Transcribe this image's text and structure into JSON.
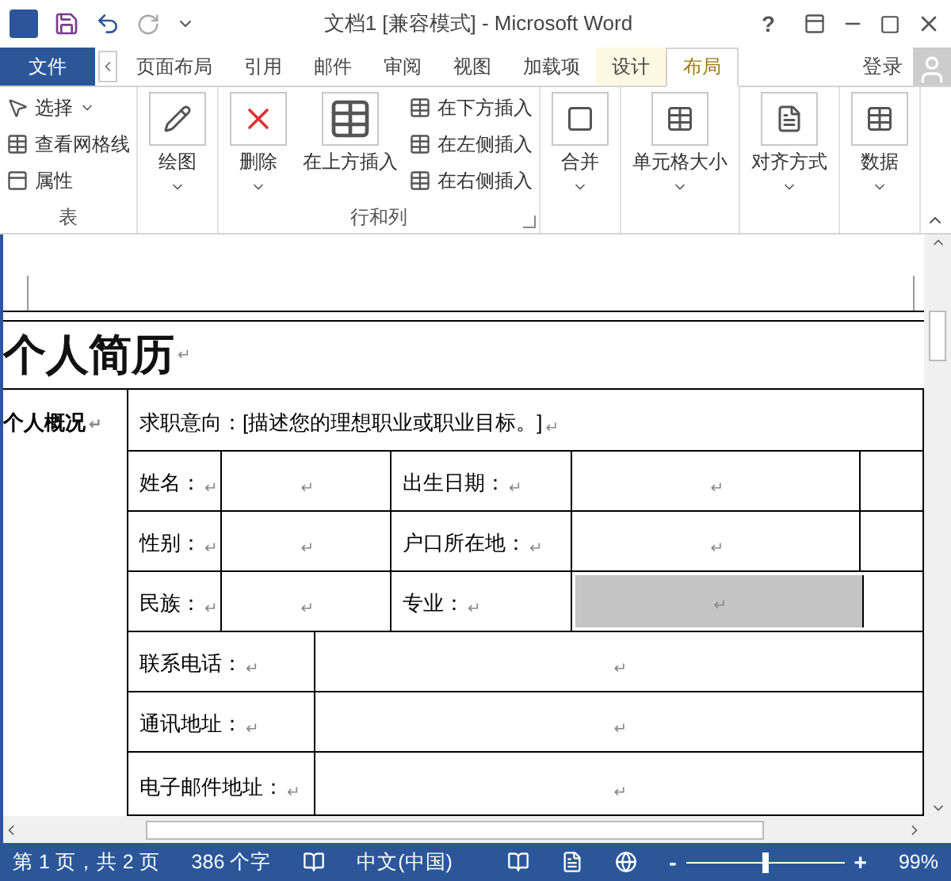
{
  "title_bar": {
    "title": "文档1 [兼容模式] - Microsoft Word",
    "help": "?"
  },
  "ribbon_tabs": [
    {
      "label": "文件",
      "kind": "file",
      "selected": false
    },
    {
      "label": "页面布局",
      "kind": "normal",
      "selected": false
    },
    {
      "label": "引用",
      "kind": "normal",
      "selected": false
    },
    {
      "label": "邮件",
      "kind": "normal",
      "selected": false
    },
    {
      "label": "审阅",
      "kind": "normal",
      "selected": false
    },
    {
      "label": "视图",
      "kind": "normal",
      "selected": false
    },
    {
      "label": "加载项",
      "kind": "normal",
      "selected": false
    },
    {
      "label": "设计",
      "kind": "context",
      "selected": false
    },
    {
      "label": "布局",
      "kind": "context",
      "selected": true
    }
  ],
  "sign_in": "登录",
  "ribbon_groups": [
    {
      "label": "表",
      "items": [
        {
          "kind": "small",
          "label": "选择",
          "caret": true
        },
        {
          "kind": "small",
          "label": "查看网格线",
          "caret": false
        },
        {
          "kind": "small",
          "label": "属性",
          "caret": false
        }
      ]
    },
    {
      "items": [
        {
          "kind": "large",
          "label": "绘图",
          "caret": true
        }
      ]
    },
    {
      "label": "行和列",
      "launcher": true,
      "items": [
        {
          "kind": "large",
          "label": "删除",
          "caret": true
        },
        {
          "kind": "large",
          "label": "在上方插入",
          "caret": false
        },
        {
          "kind": "small",
          "label": "在下方插入",
          "caret": false
        },
        {
          "kind": "small",
          "label": "在左侧插入",
          "caret": false
        },
        {
          "kind": "small",
          "label": "在右侧插入",
          "caret": false
        }
      ]
    },
    {
      "items": [
        {
          "kind": "large",
          "label": "合并",
          "caret": true
        }
      ]
    },
    {
      "items": [
        {
          "kind": "large",
          "label": "单元格大小",
          "caret": true
        }
      ]
    },
    {
      "items": [
        {
          "kind": "large",
          "label": "对齐方式",
          "caret": true
        }
      ]
    },
    {
      "items": [
        {
          "kind": "large",
          "label": "数据",
          "caret": true
        }
      ]
    }
  ],
  "document": {
    "title": "个人简历",
    "title_end": "↵",
    "section": "个人概况",
    "section_end": "↵",
    "objective": "求职意向：[描述您的理想职业或职业目标。]",
    "objective_end": "↵",
    "grid_rows": [
      [
        {
          "text": "姓名：",
          "end": "↵",
          "shaded": false
        },
        {
          "text": "",
          "end": "↵",
          "shaded": false
        },
        {
          "text": "出生日期：",
          "end": "↵",
          "shaded": false
        },
        {
          "text": "",
          "end": "↵",
          "shaded": false
        }
      ],
      [
        {
          "text": "性别：",
          "end": "↵",
          "shaded": false
        },
        {
          "text": "",
          "end": "↵",
          "shaded": false
        },
        {
          "text": "户口所在地：",
          "end": "↵",
          "shaded": false
        },
        {
          "text": "",
          "end": "↵",
          "shaded": false
        }
      ],
      [
        {
          "text": "民族：",
          "end": "↵",
          "shaded": false
        },
        {
          "text": "",
          "end": "↵",
          "shaded": false
        },
        {
          "text": "专业：",
          "end": "↵",
          "shaded": false
        },
        {
          "text": "",
          "end": "↵",
          "shaded": true
        }
      ]
    ],
    "wide_rows": [
      {
        "label": "联系电话：",
        "label_end": "↵",
        "value_end": "↵"
      },
      {
        "label": "通讯地址：",
        "label_end": "↵",
        "value_end": "↵"
      },
      {
        "label": "电子邮件地址：",
        "label_end": "↵",
        "value_end": "↵"
      }
    ]
  },
  "status_bar": {
    "page": "第 1 页，共 2 页",
    "words": "386 个字",
    "language": "中文(中国)",
    "zoom_out": "-",
    "zoom_in": "+",
    "level": 0.5,
    "zoom": "99%"
  }
}
